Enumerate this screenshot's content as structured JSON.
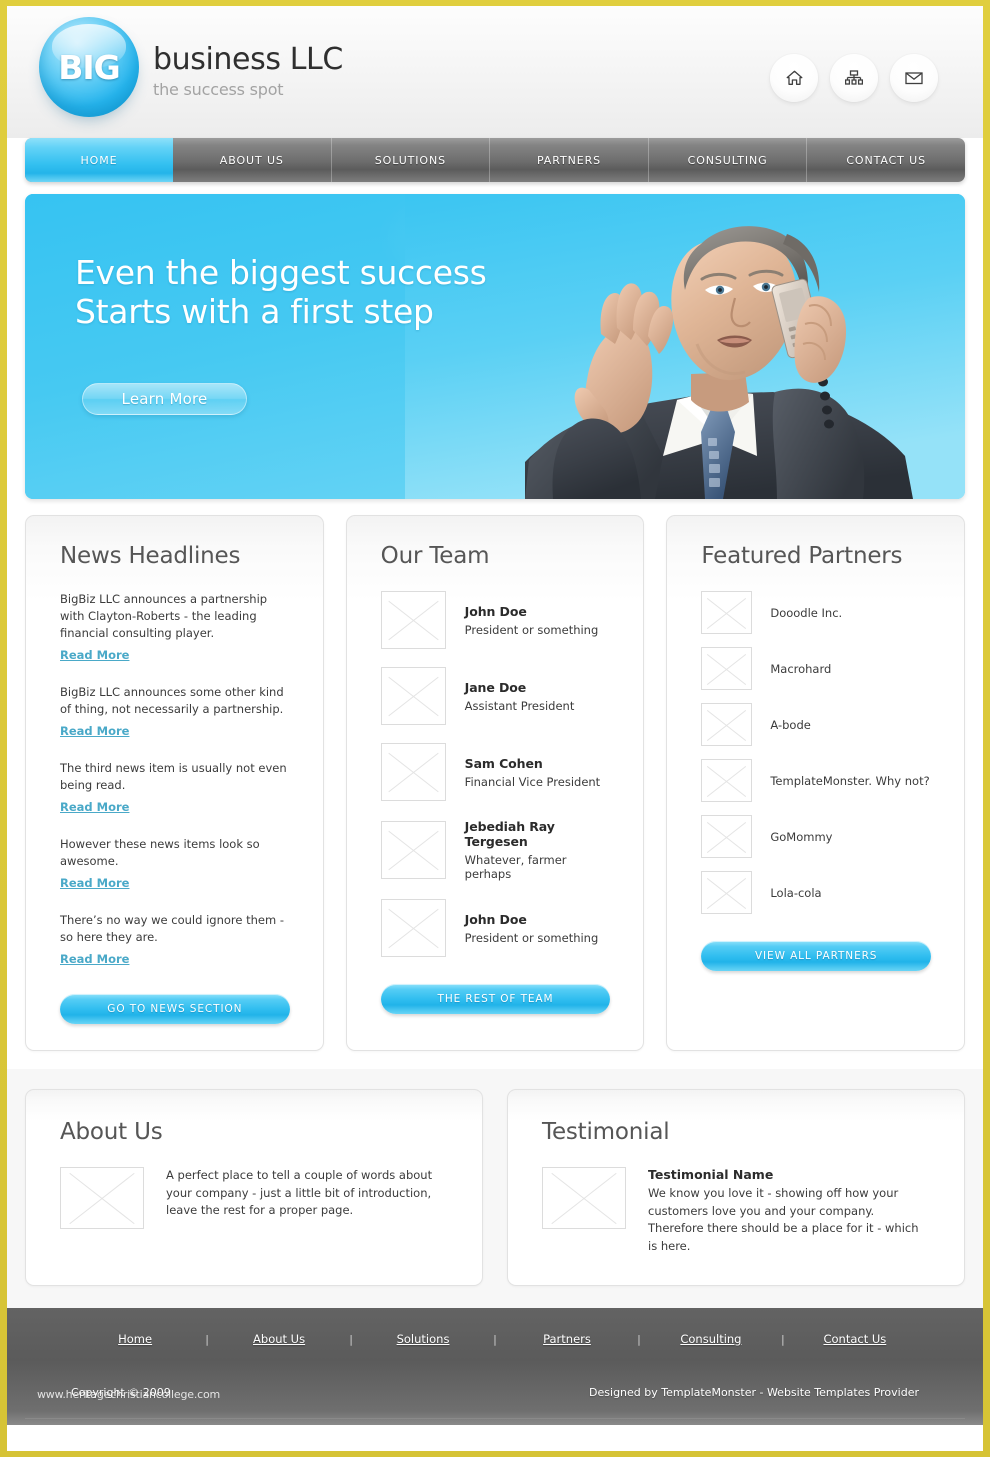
{
  "brand": {
    "orb_text": "BIG",
    "title": "business LLC",
    "tagline": "the success spot"
  },
  "header_icons": [
    {
      "name": "home-icon",
      "label": "Home"
    },
    {
      "name": "sitemap-icon",
      "label": "Sitemap"
    },
    {
      "name": "mail-icon",
      "label": "Contact"
    }
  ],
  "nav": {
    "items": [
      {
        "label": "HOME",
        "active": true
      },
      {
        "label": "ABOUT US",
        "active": false
      },
      {
        "label": "SOLUTIONS",
        "active": false
      },
      {
        "label": "PARTNERS",
        "active": false
      },
      {
        "label": "CONSULTING",
        "active": false
      },
      {
        "label": "CONTACT US",
        "active": false
      }
    ]
  },
  "hero": {
    "line1": "Even the biggest success",
    "line2": "Starts with a first step",
    "button": "Learn More",
    "accent": "#35c2f1"
  },
  "news": {
    "title": "News Headlines",
    "items": [
      {
        "text": "BigBiz LLC announces a partnership with Clayton-Roberts - the leading financial consulting player.",
        "link": "Read More"
      },
      {
        "text": "BigBiz LLC announces some other kind of thing, not necessarily a partnership.",
        "link": "Read More"
      },
      {
        "text": "The third news item is usually not even being read.",
        "link": "Read More"
      },
      {
        "text": "However these news items look so awesome.",
        "link": "Read More"
      },
      {
        "text": "There’s no way  we could ignore them - so here they are.",
        "link": "Read More"
      }
    ],
    "button": "GO TO NEWS SECTION"
  },
  "team": {
    "title": "Our Team",
    "members": [
      {
        "name": "John Doe",
        "role": "President or something"
      },
      {
        "name": "Jane Doe",
        "role": "Assistant President"
      },
      {
        "name": "Sam Cohen",
        "role": "Financial Vice President"
      },
      {
        "name": "Jebediah Ray Tergesen",
        "role": "Whatever, farmer perhaps"
      },
      {
        "name": "John Doe",
        "role": "President or something"
      }
    ],
    "button": "THE REST OF TEAM"
  },
  "partners": {
    "title": "Featured Partners",
    "items": [
      {
        "name": "Dooodle Inc."
      },
      {
        "name": "Macrohard"
      },
      {
        "name": "A-bode"
      },
      {
        "name": "TemplateMonster. Why not?"
      },
      {
        "name": "GoMommy"
      },
      {
        "name": "Lola-cola"
      }
    ],
    "button": "VIEW ALL PARTNERS"
  },
  "about": {
    "title": "About Us",
    "text": "A perfect place to tell a couple of words about your company - just a little bit of introduction, leave the rest for a proper page."
  },
  "testimonial": {
    "title": "Testimonial",
    "name": "Testimonial Name",
    "text": "We know you love it - showing off how your customers love you and your company. Therefore there should be a place for it - which is here."
  },
  "footer": {
    "links": [
      {
        "label": "Home"
      },
      {
        "label": "About Us"
      },
      {
        "label": "Solutions"
      },
      {
        "label": "Partners"
      },
      {
        "label": "Consulting"
      },
      {
        "label": "Contact Us"
      }
    ],
    "separator": "|",
    "copyright": "Copyright © 2009",
    "designed": "Designed by TemplateMonster - Website Templates Provider",
    "watermark": "www.heritagechristiancollege.com"
  }
}
